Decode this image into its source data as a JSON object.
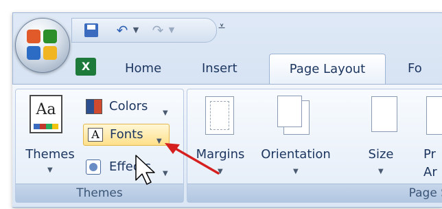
{
  "quick_access": {
    "save_icon": "save-icon",
    "undo_icon": "undo-icon",
    "redo_icon": "redo-icon",
    "customize_icon": "customize-qat-icon"
  },
  "tabs": [
    {
      "label": "Home"
    },
    {
      "label": "Insert"
    },
    {
      "label": "Page Layout",
      "active": true
    },
    {
      "label": "Fo"
    }
  ],
  "themes_group": {
    "themes_label": "Themes",
    "colors_label": "Colors",
    "fonts_label": "Fonts",
    "effects_label": "Effects",
    "group_label": "Themes"
  },
  "page_setup_group": {
    "margins_label": "Margins",
    "orientation_label": "Orientation",
    "size_label": "Size",
    "partial_label_1": "Pr",
    "partial_label_2": "Ar",
    "group_label": "Page S"
  },
  "colors": {
    "accent_arrow": "#d62020",
    "ribbon_blue": "#c9d9ee",
    "highlight": "#ffe08a"
  }
}
